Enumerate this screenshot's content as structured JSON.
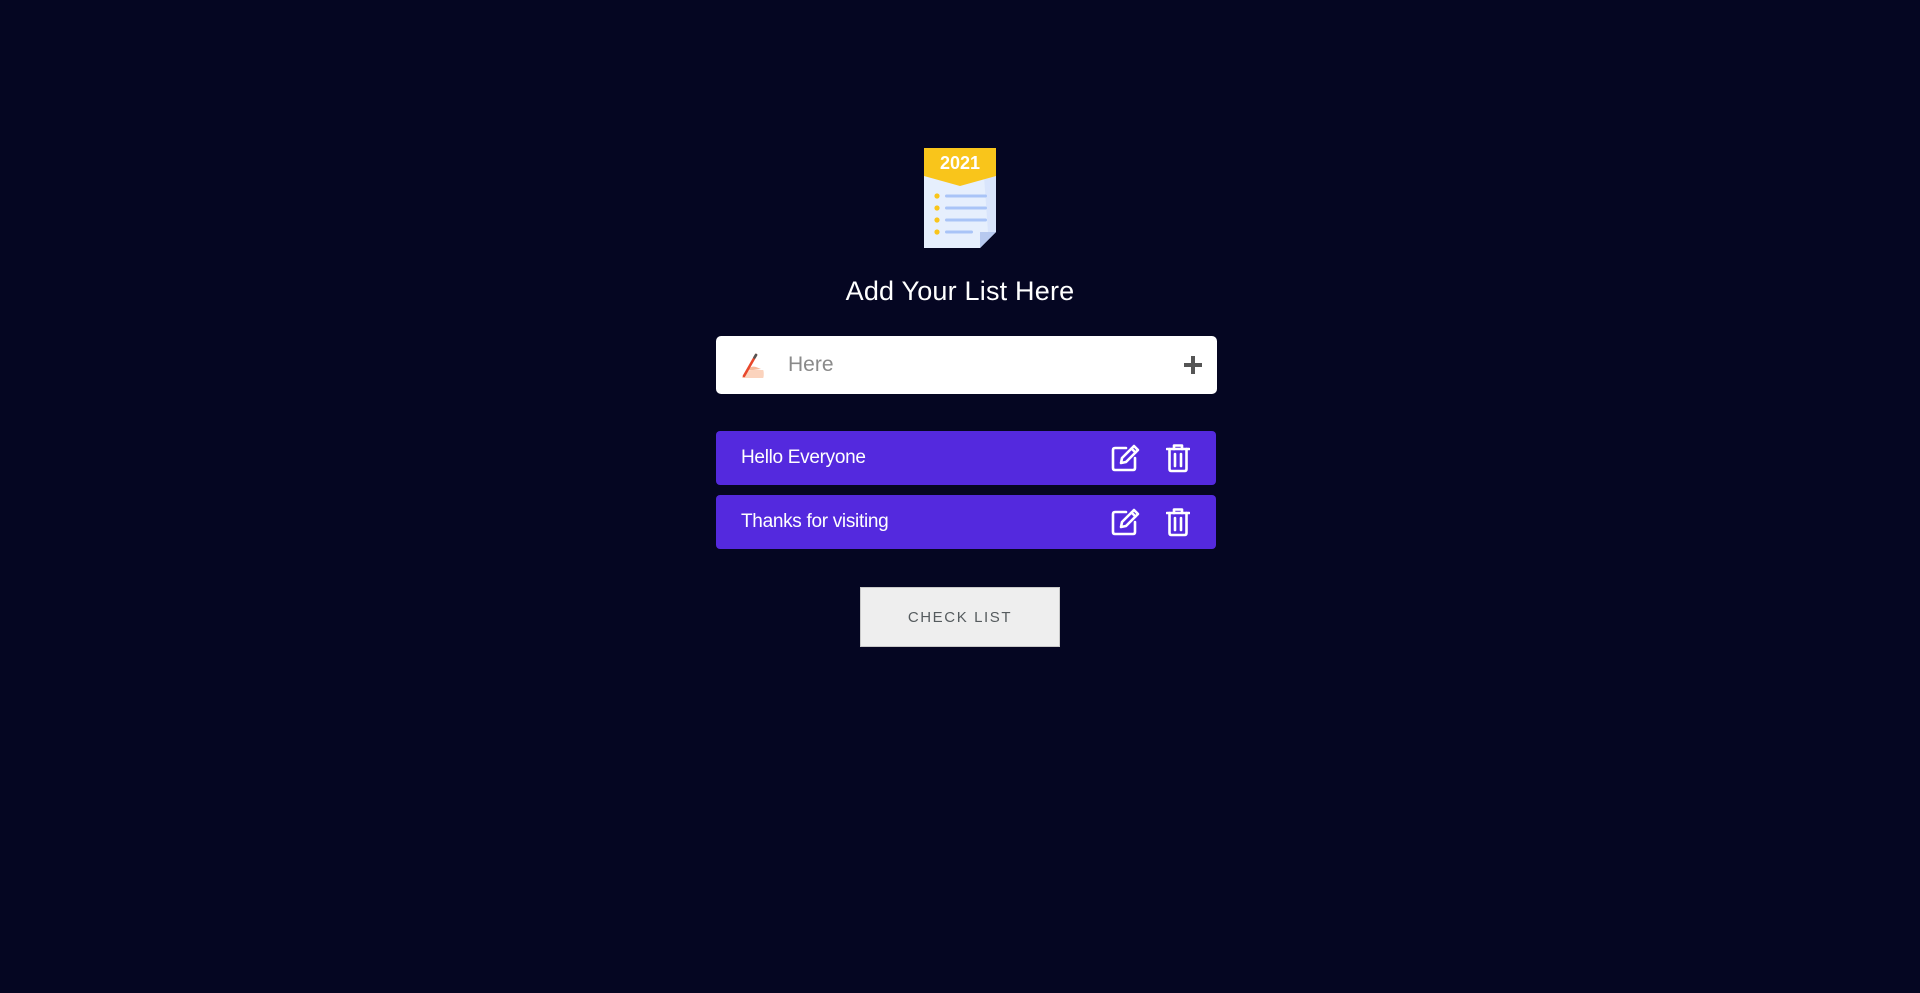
{
  "logo": {
    "year": "2021",
    "icon": "checklist-document-icon"
  },
  "heading": "Add Your List Here",
  "input": {
    "value": "",
    "placeholder": "Here",
    "leading_icon": "writing-hand-icon",
    "add_icon": "plus-icon"
  },
  "items": [
    {
      "label": "Hello Everyone",
      "edit_icon": "edit-icon",
      "delete_icon": "trash-icon"
    },
    {
      "label": "Thanks for visiting",
      "edit_icon": "edit-icon",
      "delete_icon": "trash-icon"
    }
  ],
  "check_button": "CHECK LIST",
  "colors": {
    "background": "#050622",
    "item_background": "#5429de",
    "logo_banner": "#f9c51b",
    "logo_lines": "#a9c4f7"
  }
}
